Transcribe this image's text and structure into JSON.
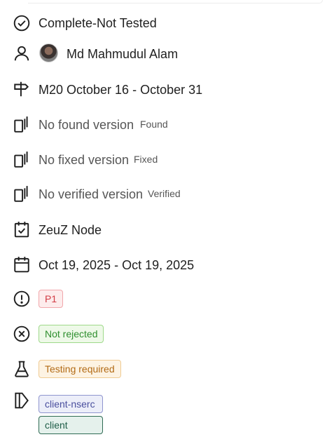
{
  "status": {
    "icon": "check-circle-icon",
    "label": "Complete-Not Tested"
  },
  "assignee": {
    "icon": "user-icon",
    "name": "Md Mahmudul Alam"
  },
  "milestone": {
    "icon": "signpost-icon",
    "label": "M20 October 16 - October 31"
  },
  "found_version": {
    "icon": "versions-icon",
    "label": "No found version",
    "tag": "Found"
  },
  "fixed_version": {
    "icon": "versions-icon",
    "label": "No fixed version",
    "tag": "Fixed"
  },
  "verified_version": {
    "icon": "versions-icon",
    "label": "No verified version",
    "tag": "Verified"
  },
  "project": {
    "icon": "calendar-check-icon",
    "label": "ZeuZ Node"
  },
  "dates": {
    "icon": "calendar-icon",
    "label": "Oct 19, 2025 - Oct 19, 2025"
  },
  "priority": {
    "icon": "alert-circle-icon",
    "label": "P1",
    "color": "#d23b44",
    "bg": "#fdecec",
    "border": "#f1a7ab"
  },
  "rejection": {
    "icon": "x-circle-icon",
    "label": "Not rejected",
    "color": "#2f8f2f",
    "bg": "#eef9e8",
    "border": "#9ed98a"
  },
  "testing": {
    "icon": "flask-icon",
    "label": "Testing required",
    "color": "#b26a14",
    "bg": "#fdf3e3",
    "border": "#f0cb92"
  },
  "labels": {
    "icon": "tag-icon",
    "items": [
      {
        "label": "client-nserc",
        "color": "#4a4f9e",
        "bg": "#eceef9",
        "border": "#8f95cf"
      },
      {
        "label": "client",
        "color": "#1f5e48",
        "bg": "#e5f1ec",
        "border": "#2f6b54"
      }
    ]
  }
}
